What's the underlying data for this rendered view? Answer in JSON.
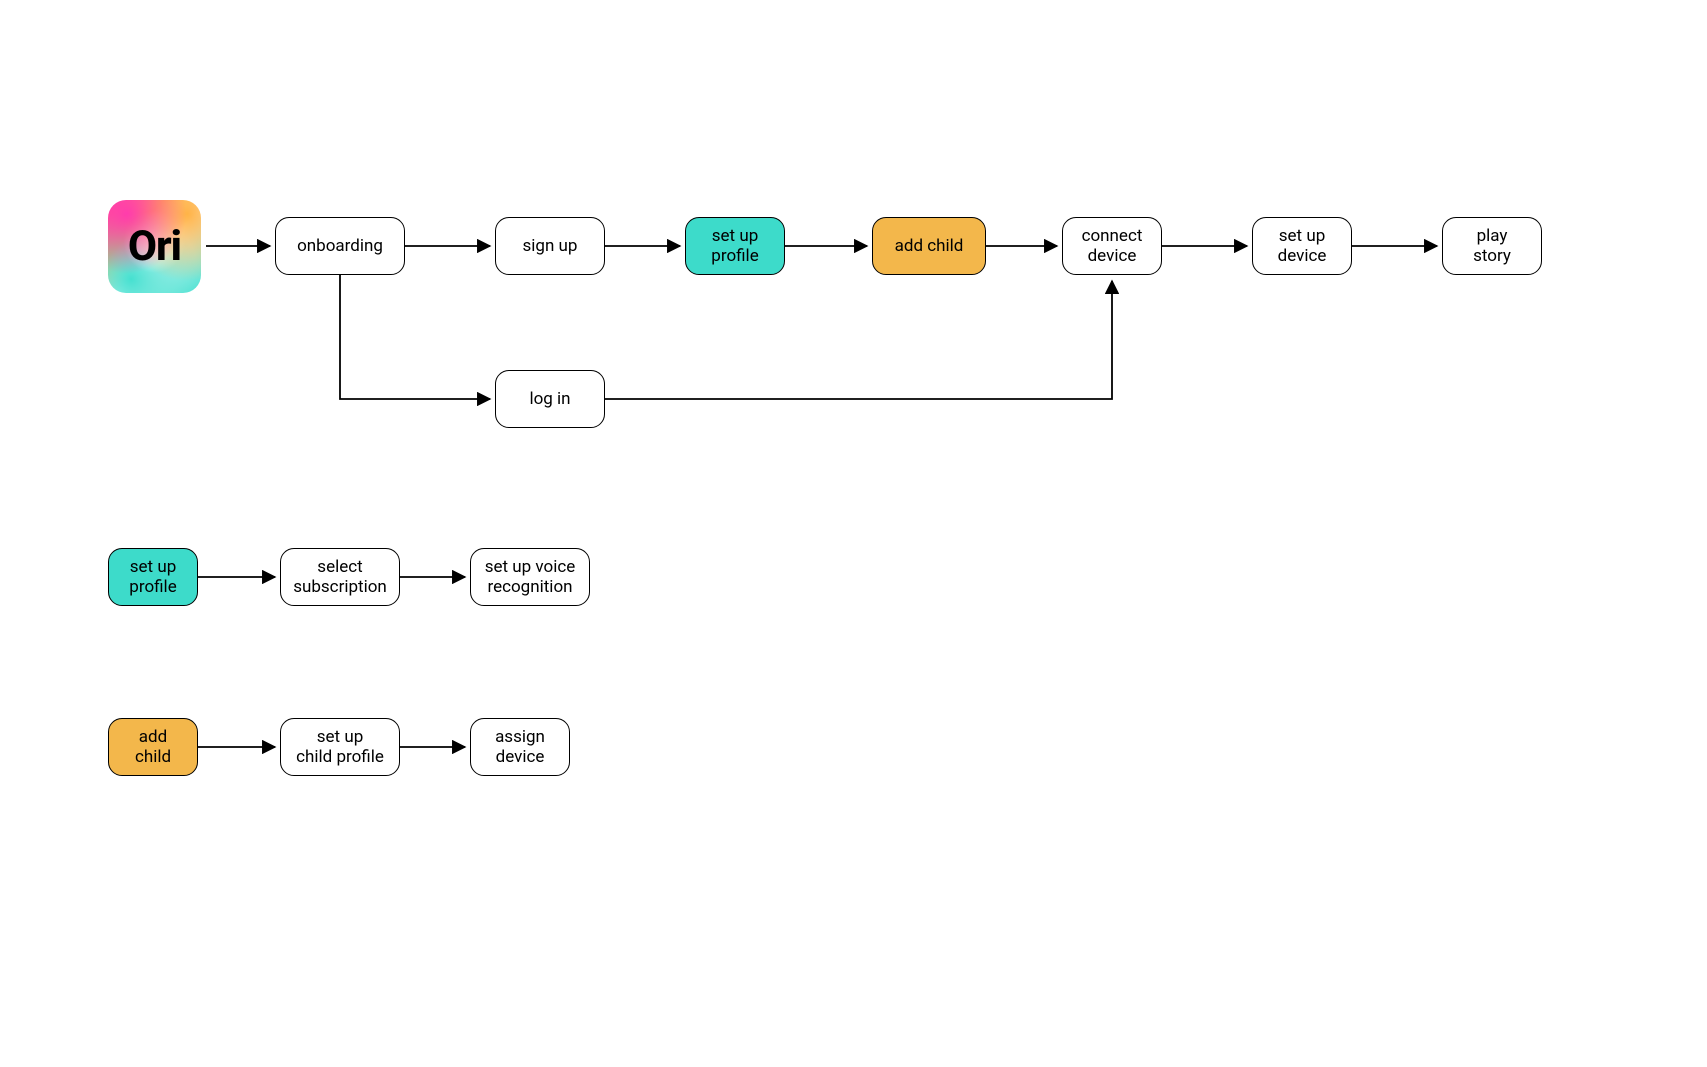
{
  "logo": {
    "text": "Ori"
  },
  "flow": {
    "main": [
      {
        "id": "onboarding",
        "label": "onboarding",
        "fill": "white"
      },
      {
        "id": "signup",
        "label": "sign up",
        "fill": "white"
      },
      {
        "id": "setup_profile",
        "label": "set up\nprofile",
        "fill": "teal"
      },
      {
        "id": "add_child",
        "label": "add child",
        "fill": "orange"
      },
      {
        "id": "connect_device",
        "label": "connect\ndevice",
        "fill": "white"
      },
      {
        "id": "setup_device",
        "label": "set up\ndevice",
        "fill": "white"
      },
      {
        "id": "play_story",
        "label": "play\nstory",
        "fill": "white"
      }
    ],
    "login": {
      "id": "login",
      "label": "log in",
      "fill": "white"
    },
    "detail_profile": [
      {
        "id": "d_setup_profile",
        "label": "set up\nprofile",
        "fill": "teal"
      },
      {
        "id": "d_select_sub",
        "label": "select\nsubscription",
        "fill": "white"
      },
      {
        "id": "d_voice_recog",
        "label": "set up voice\nrecognition",
        "fill": "white"
      }
    ],
    "detail_child": [
      {
        "id": "c_add_child",
        "label": "add\nchild",
        "fill": "orange"
      },
      {
        "id": "c_child_profile",
        "label": "set up\nchild profile",
        "fill": "white"
      },
      {
        "id": "c_assign_device",
        "label": "assign\ndevice",
        "fill": "white"
      }
    ]
  }
}
